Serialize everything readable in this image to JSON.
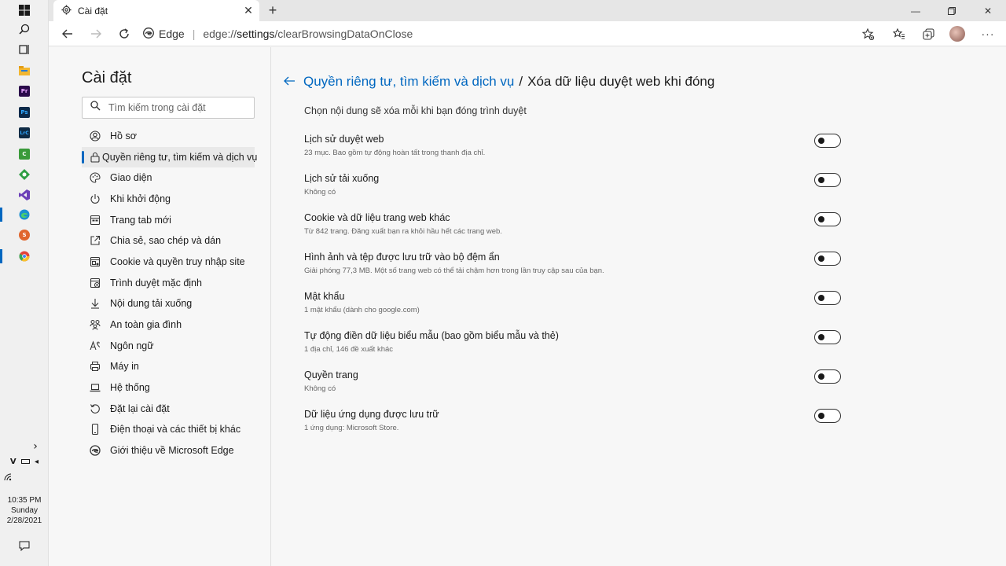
{
  "taskbar": {
    "chevron": "›",
    "clock": {
      "time": "10:35 PM",
      "day": "Sunday",
      "date": "2/28/2021"
    },
    "apps": [
      {
        "name": "windows-start-icon"
      },
      {
        "name": "search-icon"
      },
      {
        "name": "task-view-icon"
      },
      {
        "name": "file-explorer-icon",
        "color": "#f2b630"
      },
      {
        "name": "premiere-icon",
        "color": "#2a0a4a",
        "glyph": "Pr"
      },
      {
        "name": "photoshop-icon",
        "color": "#0b2a4a",
        "glyph": "Ps"
      },
      {
        "name": "lightroom-classic-icon",
        "color": "#0f2b45",
        "glyph": "LrC"
      },
      {
        "name": "camtasia-icon",
        "color": "#3a9a3a"
      },
      {
        "name": "app-green-icon",
        "color": "#2f9e44"
      },
      {
        "name": "visual-studio-icon",
        "color": "#6b3fb8"
      },
      {
        "name": "edge-icon",
        "color": "#1b8fd0"
      },
      {
        "name": "app-s-icon",
        "color": "#e0662e"
      },
      {
        "name": "chrome-icon",
        "color": "#e3443a"
      }
    ]
  },
  "browser": {
    "tab_title": "Cài đặt",
    "address": {
      "site_label": "Edge",
      "url_a": "edge://",
      "url_b": "settings",
      "url_c": "/clearBrowsingDataOnClose"
    }
  },
  "sidebar": {
    "title": "Cài đặt",
    "search_placeholder": "Tìm kiếm trong cài đặt",
    "items": [
      {
        "label": "Hồ sơ",
        "icon": "profile-icon"
      },
      {
        "label": "Quyền riêng tư, tìm kiếm và dịch vụ",
        "icon": "lock-icon",
        "selected": true
      },
      {
        "label": "Giao diện",
        "icon": "palette-icon"
      },
      {
        "label": "Khi khởi động",
        "icon": "power-icon"
      },
      {
        "label": "Trang tab mới",
        "icon": "new-tab-icon"
      },
      {
        "label": "Chia sẻ, sao chép và dán",
        "icon": "share-icon"
      },
      {
        "label": "Cookie và quyền truy nhập site",
        "icon": "site-permissions-icon"
      },
      {
        "label": "Trình duyệt mặc định",
        "icon": "default-browser-icon"
      },
      {
        "label": "Nội dung tải xuống",
        "icon": "download-icon"
      },
      {
        "label": "An toàn gia đình",
        "icon": "family-icon"
      },
      {
        "label": "Ngôn ngữ",
        "icon": "language-icon"
      },
      {
        "label": "Máy in",
        "icon": "printer-icon"
      },
      {
        "label": "Hệ thống",
        "icon": "laptop-icon"
      },
      {
        "label": "Đặt lại cài đặt",
        "icon": "reset-icon"
      },
      {
        "label": "Điện thoại và các thiết bị khác",
        "icon": "phone-icon"
      },
      {
        "label": "Giới thiệu về Microsoft Edge",
        "icon": "edge-logo-icon"
      }
    ]
  },
  "main": {
    "breadcrumb_parent": "Quyền riêng tư, tìm kiếm và dịch vụ",
    "breadcrumb_sep": "/",
    "breadcrumb_current": "Xóa dữ liệu duyệt web khi đóng",
    "description": "Chọn nội dung sẽ xóa mỗi khi bạn đóng trình duyệt",
    "options": [
      {
        "title": "Lịch sử duyệt web",
        "sub": "23 mục. Bao gồm tự động hoàn tất trong thanh địa chỉ.",
        "on": false
      },
      {
        "title": "Lịch sử tải xuống",
        "sub": "Không có",
        "on": false
      },
      {
        "title": "Cookie và dữ liệu trang web khác",
        "sub": "Từ 842 trang. Đăng xuất bạn ra khỏi hầu hết các trang web.",
        "on": false
      },
      {
        "title": "Hình ảnh và tệp được lưu trữ vào bộ đệm ẩn",
        "sub": "Giải phóng 77,3 MB. Một số trang web có thể tải chậm hơn trong lần truy cập sau của bạn.",
        "on": false
      },
      {
        "title": "Mật khẩu",
        "sub": "1 mật khẩu (dành cho google.com)",
        "on": false
      },
      {
        "title": "Tự động điền dữ liệu biểu mẫu (bao gồm biểu mẫu và thẻ)",
        "sub": "1 địa chỉ, 146 đề xuất khác",
        "on": false
      },
      {
        "title": "Quyền trang",
        "sub": "Không có",
        "on": false
      },
      {
        "title": "Dữ liệu ứng dụng được lưu trữ",
        "sub": "1 ứng dụng: Microsoft Store.",
        "on": false
      }
    ]
  },
  "colors": {
    "accent": "#0067c0",
    "background": "#f7f7f7"
  }
}
